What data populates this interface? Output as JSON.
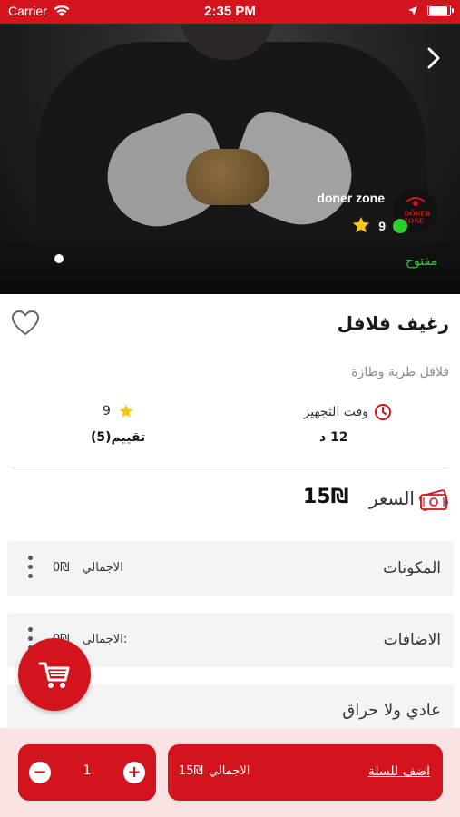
{
  "status_bar": {
    "carrier": "Carrier",
    "time": "2:35 PM",
    "battery_level": 0.9
  },
  "colors": {
    "accent": "#d3141c",
    "open_green": "#2ecc2e",
    "star": "#f5c518",
    "bottom_bg": "#fbe3e4"
  },
  "hero": {
    "restaurant_name": "doner zone",
    "logo_text_1": "DÖNER",
    "logo_text_2": "ZONE",
    "rating": "9",
    "open_status": "مفتوح",
    "carousel_page": 1
  },
  "product": {
    "title": "رغيف فلافل",
    "description": "فلافل طرية وطازة",
    "prep_time_label": "وقت التجهيز",
    "prep_time_value": "12 د",
    "rating_value": "9",
    "rating_count_label": "تقييم(5)",
    "price_label": "السعر",
    "price_value": "15₪"
  },
  "sections": {
    "ingredients": {
      "title": "المكونات",
      "total_label": "الاجمالي",
      "total_value": "0₪"
    },
    "extras": {
      "title": "الاضافات",
      "total_label": "الاجمالي:",
      "total_value": "0₪"
    },
    "option": {
      "title": "عادي ولا حراق"
    }
  },
  "bottom_bar": {
    "quantity": "1",
    "minus": "−",
    "plus": "+",
    "add_to_cart": "اضف للسلة",
    "total_label": "الاجمالي",
    "total_value": "15₪"
  },
  "icons": [
    "wifi-icon",
    "location-arrow-icon",
    "battery-icon",
    "chevron-right-icon",
    "star-icon",
    "heart-icon",
    "clock-icon",
    "money-icon",
    "kebab-menu-icon",
    "cart-icon"
  ]
}
